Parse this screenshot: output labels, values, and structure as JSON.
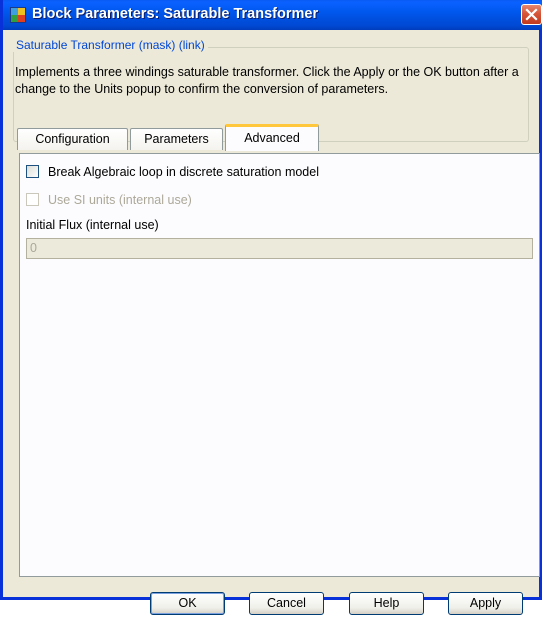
{
  "window": {
    "title": "Block Parameters: Saturable Transformer",
    "icon": "simulink-block-icon",
    "close_icon": "close-icon"
  },
  "group": {
    "legend": "Saturable Transformer (mask) (link)",
    "description": "Implements a three windings saturable transformer. Click the Apply or the OK button after a change to the Units popup to confirm the conversion of parameters."
  },
  "tabs": [
    {
      "label": "Configuration",
      "active": false
    },
    {
      "label": "Parameters",
      "active": false
    },
    {
      "label": "Advanced",
      "active": true
    }
  ],
  "advanced": {
    "break_loop": {
      "label": "Break Algebraic loop in discrete saturation model",
      "checked": false,
      "enabled": true
    },
    "si_units": {
      "label": "Use SI units (internal use)",
      "checked": false,
      "enabled": false
    },
    "initial_flux": {
      "label": "Initial Flux (internal use)",
      "value": "0",
      "enabled": false
    }
  },
  "buttons": {
    "ok": "OK",
    "cancel": "Cancel",
    "help": "Help",
    "apply": "Apply"
  },
  "colors": {
    "titlebar": "#0054e3",
    "dialog_bg": "#ece9d8",
    "legend_text": "#0046d5",
    "tab_highlight": "#ffc83c"
  }
}
